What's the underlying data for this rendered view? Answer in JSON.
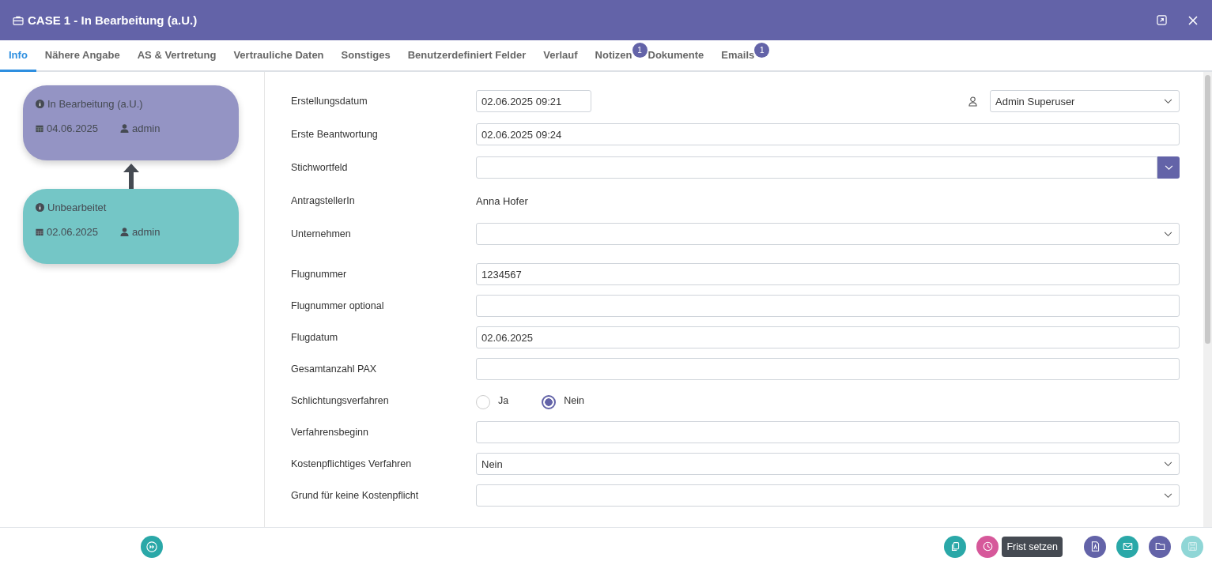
{
  "window": {
    "title": "CASE 1 - In Bearbeitung (a.U.)"
  },
  "tabs": [
    {
      "label": "Info",
      "selected": true
    },
    {
      "label": "Nähere Angabe",
      "selected": false
    },
    {
      "label": "AS & Vertretung",
      "selected": false
    },
    {
      "label": "Vertrauliche Daten",
      "selected": false
    },
    {
      "label": "Sonstiges",
      "selected": false
    },
    {
      "label": "Benutzerdefiniert Felder",
      "selected": false
    },
    {
      "label": "Verlauf",
      "selected": false
    },
    {
      "label": "Notizen",
      "selected": false,
      "badge": "1"
    },
    {
      "label": "Dokumente",
      "selected": false
    },
    {
      "label": "Emails",
      "selected": false,
      "badge": "1"
    }
  ],
  "history": [
    {
      "status": "In Bearbeitung (a.U.)",
      "date": "04.06.2025",
      "user": "admin",
      "color": "#9494c4"
    },
    {
      "status": "Unbearbeitet",
      "date": "02.06.2025",
      "user": "admin",
      "color": "#74c6c6"
    }
  ],
  "sections": [
    [
      {
        "kind": "datetime",
        "label": "Erstellungsdatum",
        "value": "02.06.2025 09:21",
        "assignee": "Admin Superuser"
      },
      {
        "kind": "input",
        "label": "Erste Beantwortung",
        "value": "02.06.2025 09:24"
      },
      {
        "kind": "combo",
        "label": "Stichwortfeld"
      },
      {
        "kind": "text",
        "label": "AntragstellerIn",
        "value": "Anna Hofer"
      },
      {
        "kind": "select",
        "label": "Unternehmen"
      }
    ],
    [
      {
        "kind": "input",
        "label": "Flugnummer",
        "value": "1234567"
      },
      {
        "kind": "input",
        "label": "Flugnummer optional"
      },
      {
        "kind": "input",
        "label": "Flugdatum",
        "value": "02.06.2025"
      },
      {
        "kind": "input",
        "label": "Gesamtanzahl PAX"
      },
      {
        "kind": "radio",
        "label": "Schlichtungsverfahren",
        "options": [
          {
            "label": "Ja",
            "selected": false
          },
          {
            "label": "Nein",
            "selected": true
          }
        ]
      },
      {
        "kind": "input",
        "label": "Verfahrensbeginn"
      },
      {
        "kind": "select",
        "label": "Kostenpflichtiges Verfahren",
        "value": "Nein"
      },
      {
        "kind": "select",
        "label": "Grund für keine Kostenpflicht"
      }
    ]
  ],
  "footer": {
    "actions": [
      {
        "kind": "copy",
        "color": "#2aa8a8",
        "disabled": false
      },
      {
        "kind": "clock",
        "color": "#d6589a",
        "disabled": false,
        "tooltip": "Frist setzen"
      },
      {
        "kind": "pdf",
        "color": "#6363a8",
        "disabled": false
      },
      {
        "kind": "mail",
        "color": "#2aa8a8",
        "disabled": false
      },
      {
        "kind": "folder",
        "color": "#6363a8",
        "disabled": false
      },
      {
        "kind": "save",
        "color": "#8fd6d6",
        "disabled": true
      }
    ]
  }
}
